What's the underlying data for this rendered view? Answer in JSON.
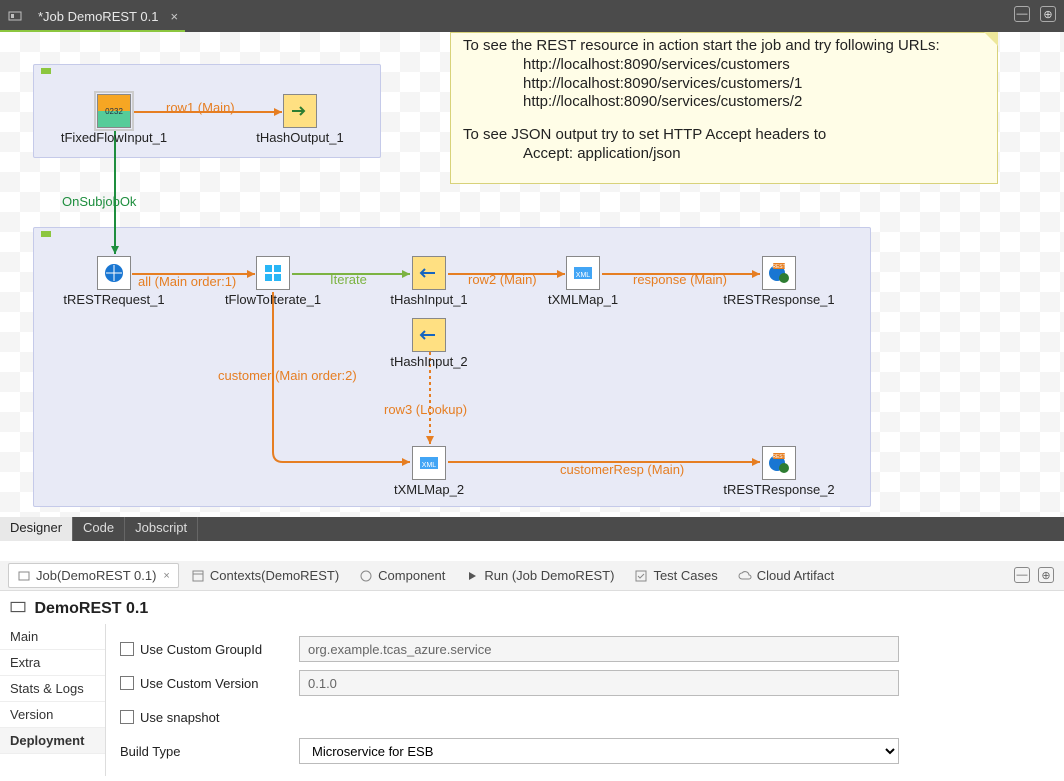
{
  "titlebar": {
    "title": "*Job DemoREST 0.1",
    "close_x": "×",
    "minimize_glyph": "—",
    "maximize_glyph": "⊕"
  },
  "editor_tabs": {
    "designer": "Designer",
    "code": "Code",
    "jobscript": "Jobscript"
  },
  "note": {
    "line1": "To see the REST resource in action start the job and try following URLs:",
    "line2": "http://localhost:8090/services/customers",
    "line3": "http://localhost:8090/services/customers/1",
    "line4": "http://localhost:8090/services/customers/2",
    "line5": "To see JSON output try to set HTTP Accept headers to",
    "line6": "Accept: application/json"
  },
  "components": {
    "tFixedFlowInput_1": "tFixedFlowInput_1",
    "tHashOutput_1": "tHashOutput_1",
    "tRESTRequest_1": "tRESTRequest_1",
    "tFlowToIterate_1": "tFlowToIterate_1",
    "tHashInput_1": "tHashInput_1",
    "tXMLMap_1": "tXMLMap_1",
    "tRESTResponse_1": "tRESTResponse_1",
    "tHashInput_2": "tHashInput_2",
    "tXMLMap_2": "tXMLMap_2",
    "tRESTResponse_2": "tRESTResponse_2"
  },
  "edges": {
    "row1": "row1 (Main)",
    "onSubjobOk": "OnSubjobOk",
    "all": "all (Main order:1)",
    "iterate": "Iterate",
    "row2": "row2 (Main)",
    "response": "response (Main)",
    "customer": "customer (Main order:2)",
    "row3": "row3 (Lookup)",
    "customerResp": "customerResp (Main)"
  },
  "views": {
    "job": "Job(DemoREST 0.1)",
    "contexts": "Contexts(DemoREST)",
    "component": "Component",
    "run": "Run (Job DemoREST)",
    "testcases": "Test Cases",
    "cloud": "Cloud Artifact",
    "close_x": "×"
  },
  "propTitle": "DemoREST 0.1",
  "sideTabs": {
    "main": "Main",
    "extra": "Extra",
    "stats": "Stats & Logs",
    "version": "Version",
    "deployment": "Deployment"
  },
  "form": {
    "useCustomGroupId": "Use Custom GroupId",
    "groupIdValue": "org.example.tcas_azure.service",
    "useCustomVersion": "Use Custom Version",
    "versionValue": "0.1.0",
    "useSnapshot": "Use snapshot",
    "buildType": "Build Type",
    "buildTypeValue": "Microservice for ESB"
  }
}
